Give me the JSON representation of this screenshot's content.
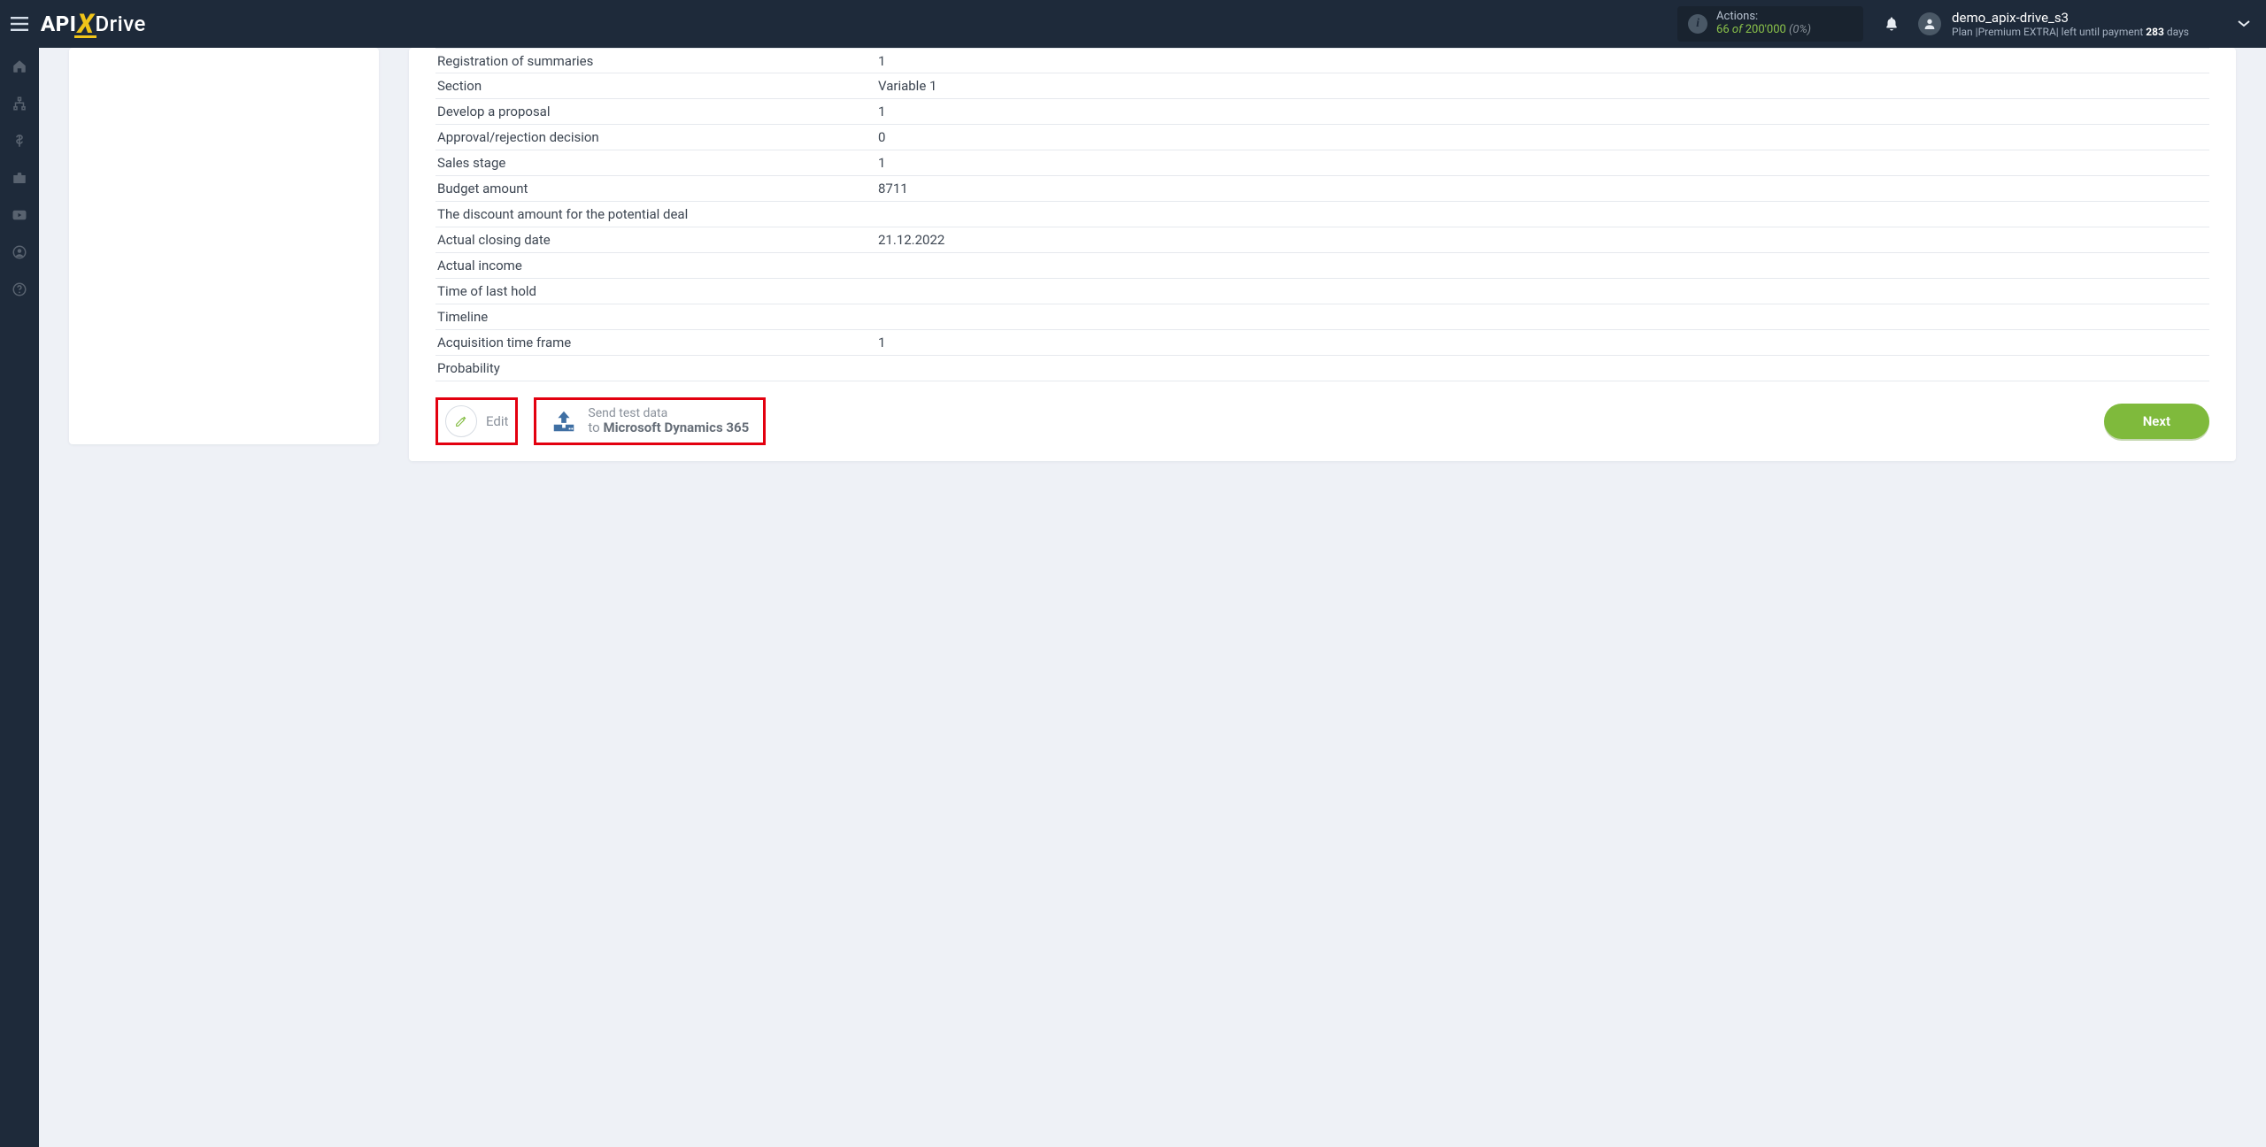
{
  "logo": {
    "p1": "API",
    "p2": "X",
    "p3": "Drive"
  },
  "actions": {
    "label": "Actions:",
    "used": "66",
    "of_word": "of",
    "total": "200'000",
    "pct": "(0%)"
  },
  "user": {
    "name": "demo_apix-drive_s3",
    "plan_prefix": "Plan |",
    "plan_name": "Premium EXTRA",
    "plan_mid": "| left until payment ",
    "days_num": "283",
    "days_word": " days"
  },
  "rows": [
    {
      "k": "Registration of summaries",
      "v": "1"
    },
    {
      "k": "Section",
      "v": "Variable 1"
    },
    {
      "k": "Develop a proposal",
      "v": "1"
    },
    {
      "k": "Approval/rejection decision",
      "v": "0"
    },
    {
      "k": "Sales stage",
      "v": "1"
    },
    {
      "k": "Budget amount",
      "v": "8711"
    },
    {
      "k": "The discount amount for the potential deal",
      "v": ""
    },
    {
      "k": "Actual closing date",
      "v": "21.12.2022"
    },
    {
      "k": "Actual income",
      "v": ""
    },
    {
      "k": "Time of last hold",
      "v": ""
    },
    {
      "k": "Timeline",
      "v": ""
    },
    {
      "k": "Acquisition time frame",
      "v": "1"
    },
    {
      "k": "Probability",
      "v": ""
    }
  ],
  "edit_label": "Edit",
  "send": {
    "l1": "Send test data",
    "to": "to ",
    "target": "Microsoft Dynamics 365"
  },
  "next_label": "Next"
}
